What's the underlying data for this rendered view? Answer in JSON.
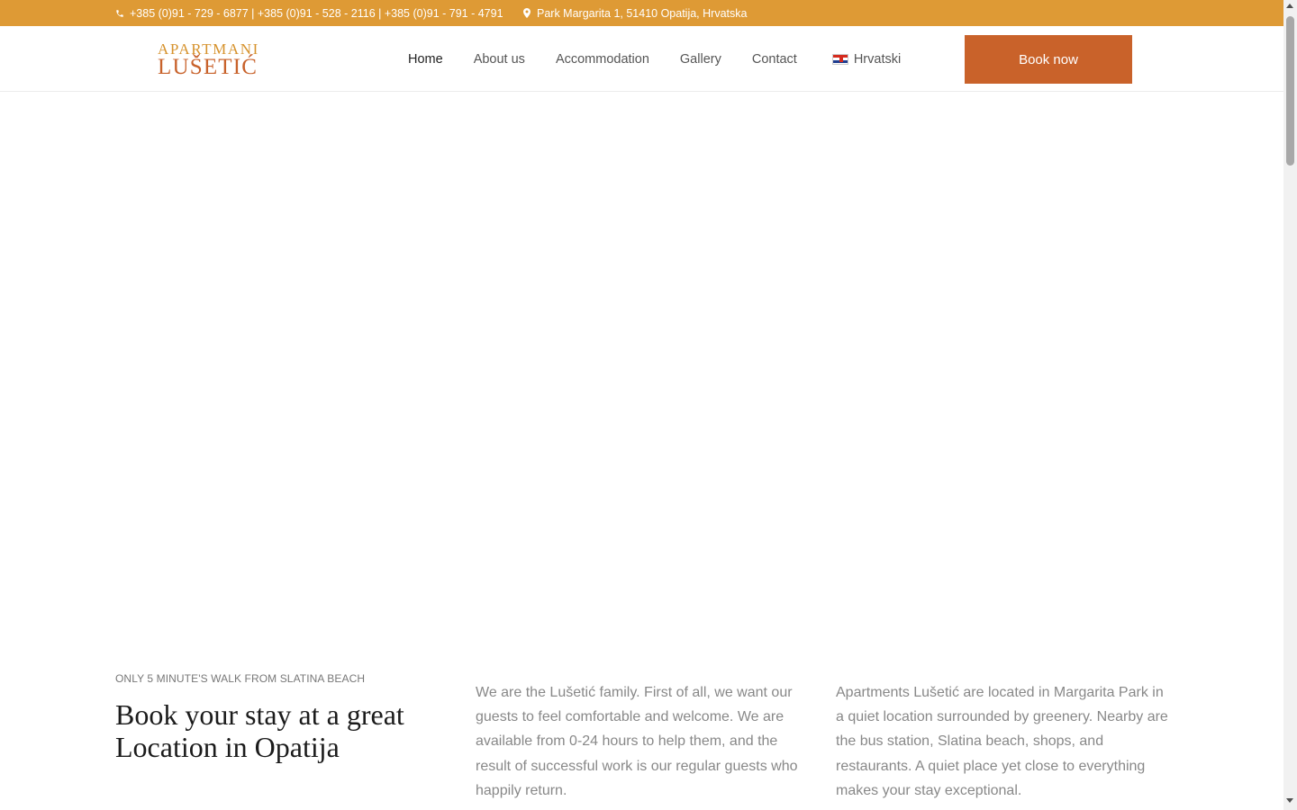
{
  "topbar": {
    "phone_icon": "phone-icon",
    "phone": "+385 (0)91 - 729 - 6877 | +385 (0)91 - 528 - 2116 | +385 (0)91 - 791 - 4791",
    "address_icon": "map-pin-icon",
    "address": "Park Margarita 1, 51410 Opatija, Hrvatska"
  },
  "logo": {
    "line1": "APARTMANI",
    "line2": "LUŠETIĆ"
  },
  "nav": {
    "items": [
      {
        "label": "Home",
        "active": true
      },
      {
        "label": "About us",
        "active": false
      },
      {
        "label": "Accommodation",
        "active": false
      },
      {
        "label": "Gallery",
        "active": false
      },
      {
        "label": "Contact",
        "active": false
      }
    ],
    "language": "Hrvatski",
    "language_icon": "croatian-flag-icon"
  },
  "cta": {
    "book_label": "Book now"
  },
  "intro": {
    "kicker": "ONLY 5 MINUTE'S WALK FROM SLATINA BEACH",
    "headline": "Book your stay at a great Location in Opatija",
    "paragraph1": "We are the Lušetić family. First of all, we want our guests to feel comfortable and welcome. We are available from 0-24 hours to help them, and the result of successful work is our regular guests who happily return.",
    "paragraph2": "Apartments Lušetić are located in Margarita Park in a quiet location surrounded by greenery. Nearby are the bus station, Slatina beach, shops, and restaurants. A quiet place yet close to everything makes your stay exceptional."
  },
  "colors": {
    "topbar": "#de9a35",
    "logo_top": "#d6922c",
    "logo_bottom": "#c8622b",
    "cta": "#c9622a"
  }
}
